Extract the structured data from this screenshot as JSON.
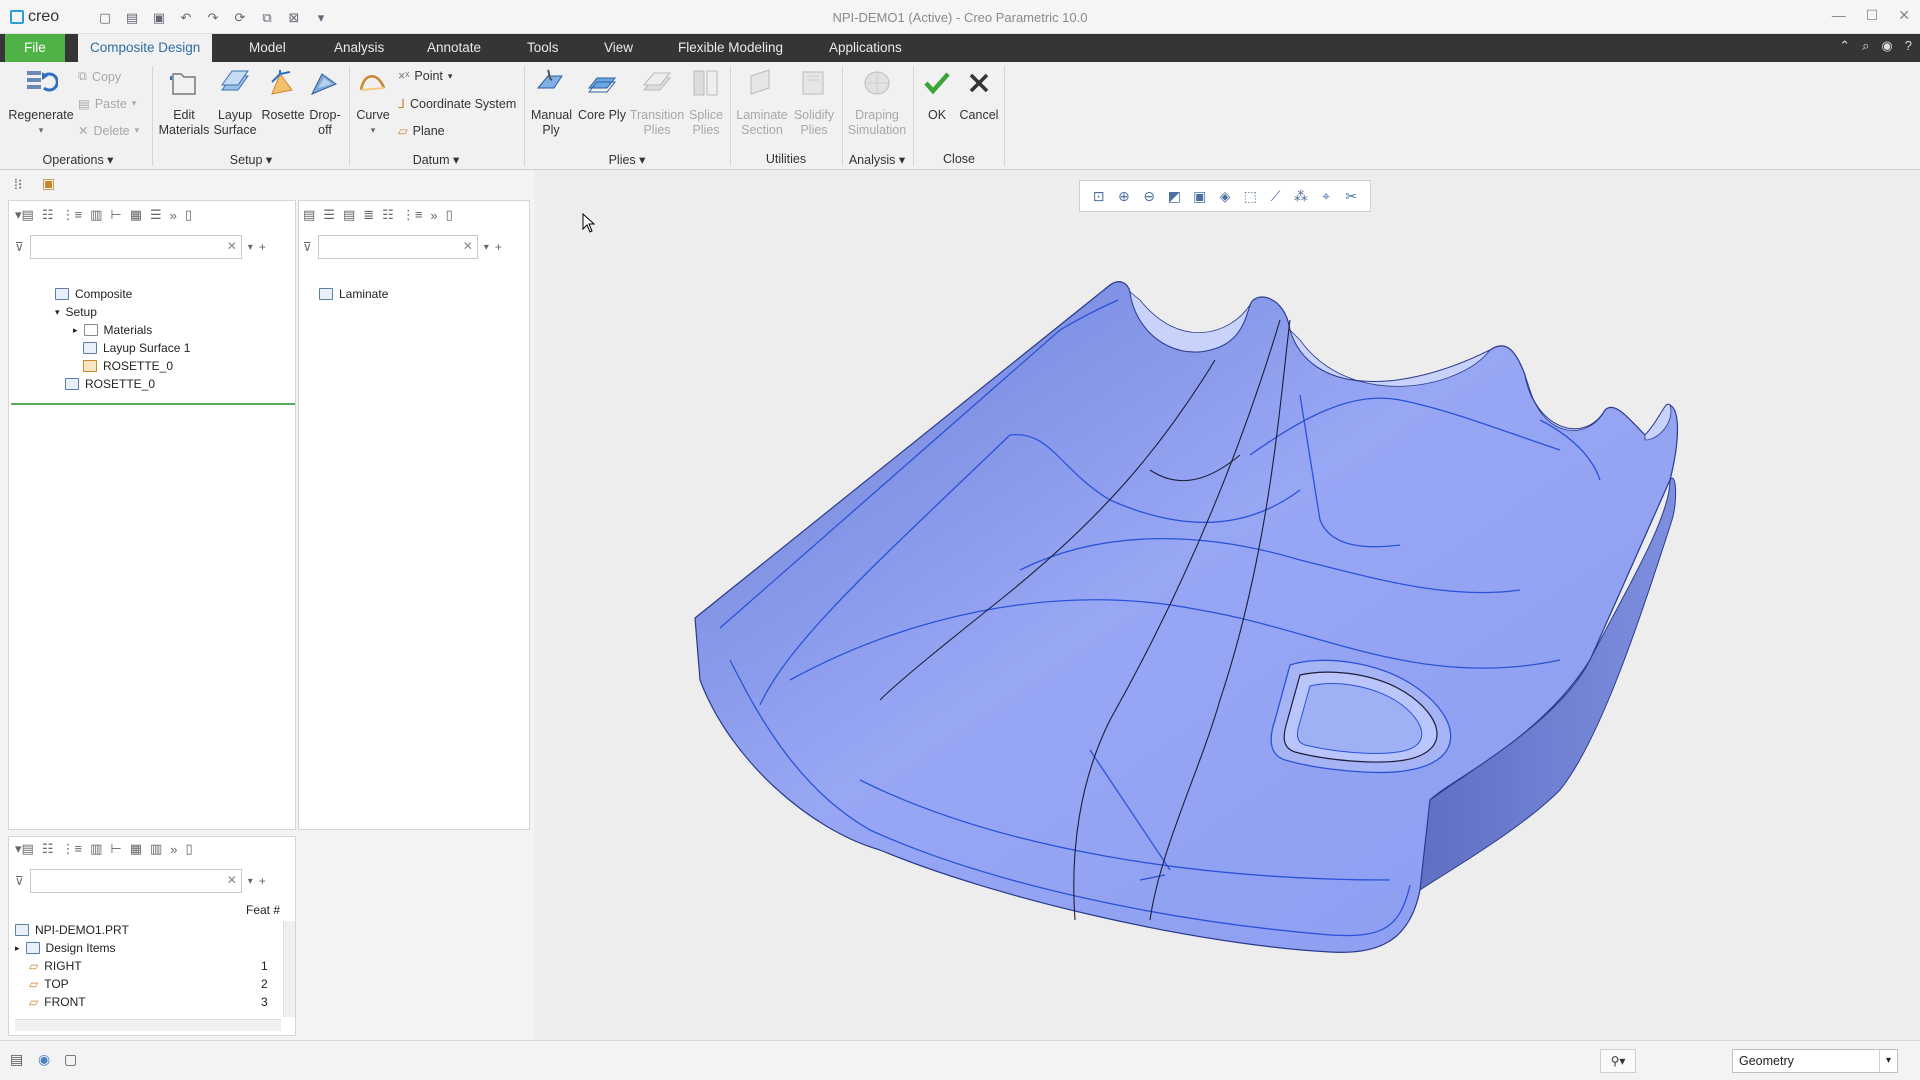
{
  "app": {
    "logo_text": "creo",
    "window_title": "NPI-DEMO1 (Active) - Creo Parametric 10.0"
  },
  "tabs": {
    "file": "File",
    "items": [
      "Composite Design",
      "Model",
      "Analysis",
      "Annotate",
      "Tools",
      "View",
      "Flexible Modeling",
      "Applications"
    ]
  },
  "ribbon": {
    "operations": {
      "regenerate": "Regenerate",
      "copy": "Copy",
      "paste": "Paste",
      "delete": "Delete",
      "group": "Operations"
    },
    "setup": {
      "edit_materials": "Edit Materials",
      "layup_surface": "Layup Surface",
      "rosette": "Rosette",
      "drop_off": "Drop-off",
      "group": "Setup"
    },
    "datum": {
      "curve": "Curve",
      "point": "Point",
      "coordinate_system": "Coordinate System",
      "plane": "Plane",
      "group": "Datum"
    },
    "plies": {
      "manual_ply": "Manual Ply",
      "core_ply": "Core Ply",
      "transition_plies": "Transition Plies",
      "splice_plies": "Splice Plies",
      "group": "Plies"
    },
    "utilities": {
      "laminate_section": "Laminate Section",
      "solidify_plies": "Solidify Plies",
      "group": "Utilities"
    },
    "analysis": {
      "draping_simulation": "Draping Simulation",
      "group": "Analysis"
    },
    "close": {
      "ok": "OK",
      "cancel": "Cancel",
      "group": "Close"
    }
  },
  "composite_tree": {
    "items": [
      {
        "label": "Composite",
        "level": 0
      },
      {
        "label": "Setup",
        "level": 1
      },
      {
        "label": "Materials",
        "level": 2
      },
      {
        "label": "Layup Surface 1",
        "level": 2
      },
      {
        "label": "ROSETTE_0",
        "level": 2
      },
      {
        "label": "ROSETTE_0",
        "level": 1
      }
    ]
  },
  "laminate_tree": {
    "items": [
      {
        "label": "Laminate"
      }
    ]
  },
  "model_tree": {
    "column_header": "Feat #",
    "items": [
      {
        "label": "NPI-DEMO1.PRT",
        "feat": ""
      },
      {
        "label": "Design Items",
        "feat": ""
      },
      {
        "label": "RIGHT",
        "feat": "1"
      },
      {
        "label": "TOP",
        "feat": "2"
      },
      {
        "label": "FRONT",
        "feat": "3"
      }
    ]
  },
  "statusbar": {
    "selection_filter": "Geometry"
  },
  "colors": {
    "file_tab": "#4eb245",
    "tab_bar": "#353535",
    "active_tab_text": "#2d6ea3",
    "part_fill": "#8fa1f2",
    "part_edge": "#2a4fd9"
  }
}
